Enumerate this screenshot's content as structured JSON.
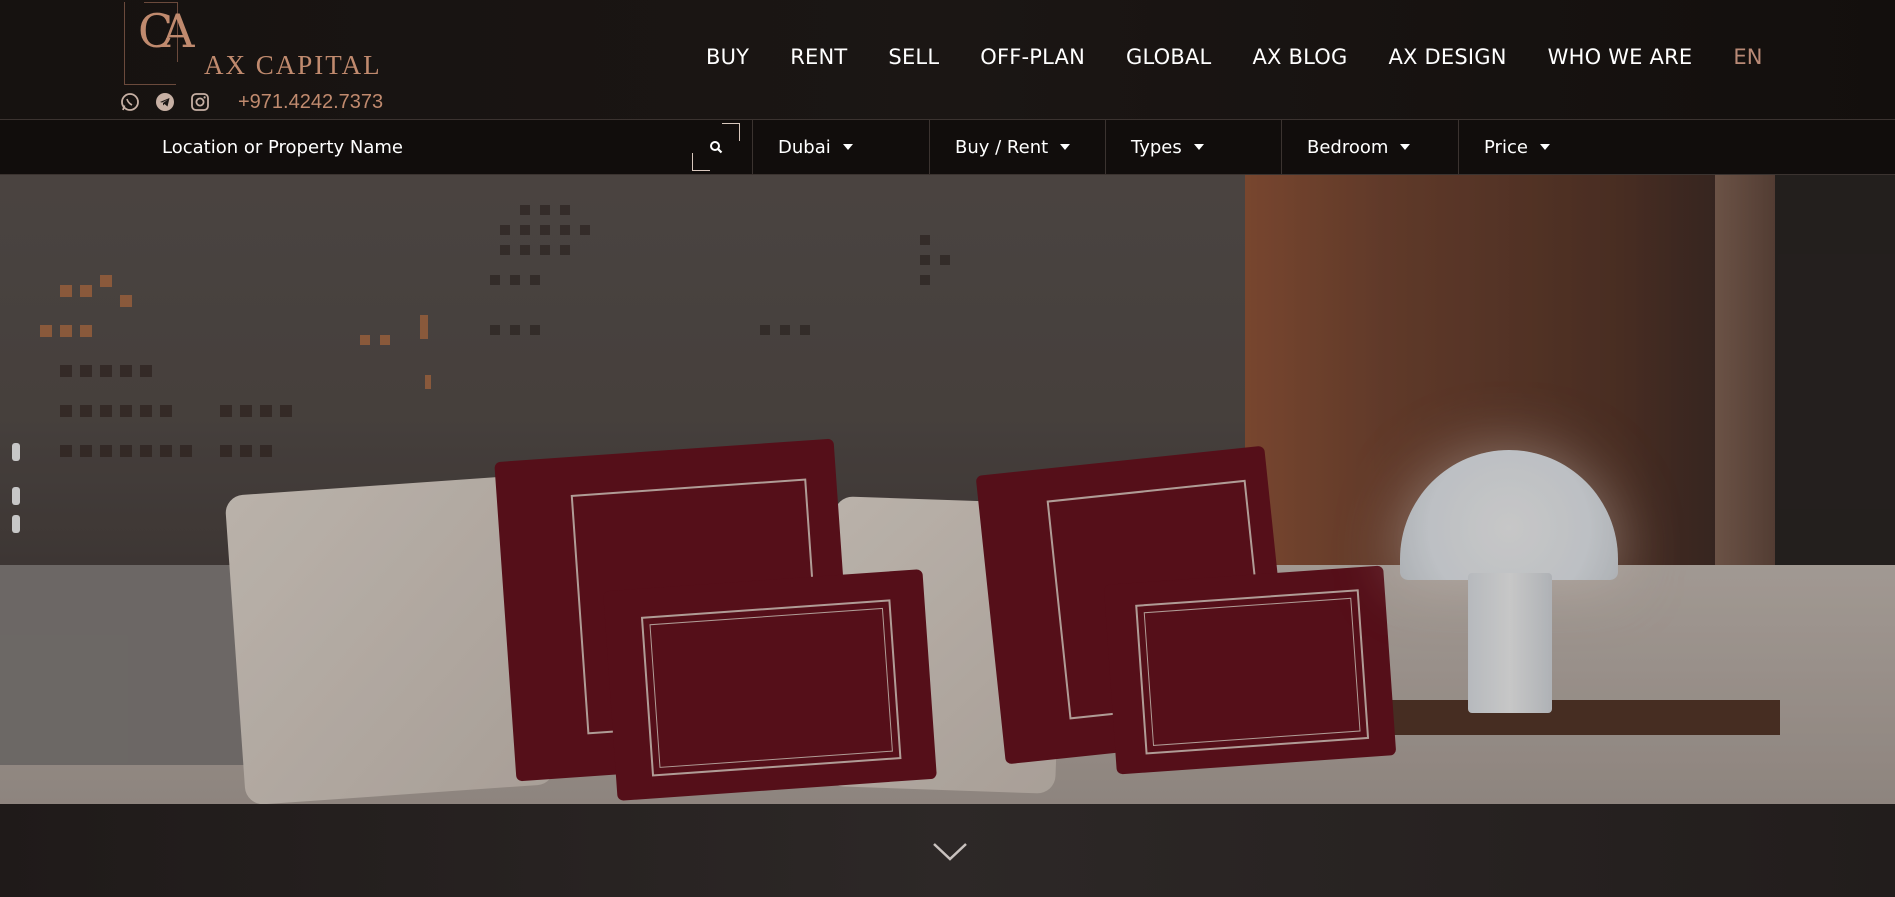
{
  "brand": {
    "logo_mark": "CA",
    "name": "AX CAPITAL",
    "accent_color": "#c08a6e"
  },
  "contact": {
    "icons": [
      "whatsapp-icon",
      "telegram-icon",
      "instagram-icon"
    ],
    "phone": "+971.4242.7373"
  },
  "nav": {
    "items": [
      {
        "label": "BUY"
      },
      {
        "label": "RENT"
      },
      {
        "label": "SELL"
      },
      {
        "label": "OFF-PLAN"
      },
      {
        "label": "GLOBAL"
      },
      {
        "label": "AX BLOG"
      },
      {
        "label": "AX DESIGN"
      },
      {
        "label": "WHO WE ARE"
      }
    ],
    "language": "EN"
  },
  "search": {
    "placeholder": "Location or Property Name",
    "value": "",
    "button_icon": "search-icon"
  },
  "filters": {
    "city": "Dubai",
    "deal": "Buy / Rent",
    "types": "Types",
    "bedroom": "Bedroom",
    "price": "Price"
  },
  "hero": {
    "scroll_icon": "chevron-down-icon"
  }
}
